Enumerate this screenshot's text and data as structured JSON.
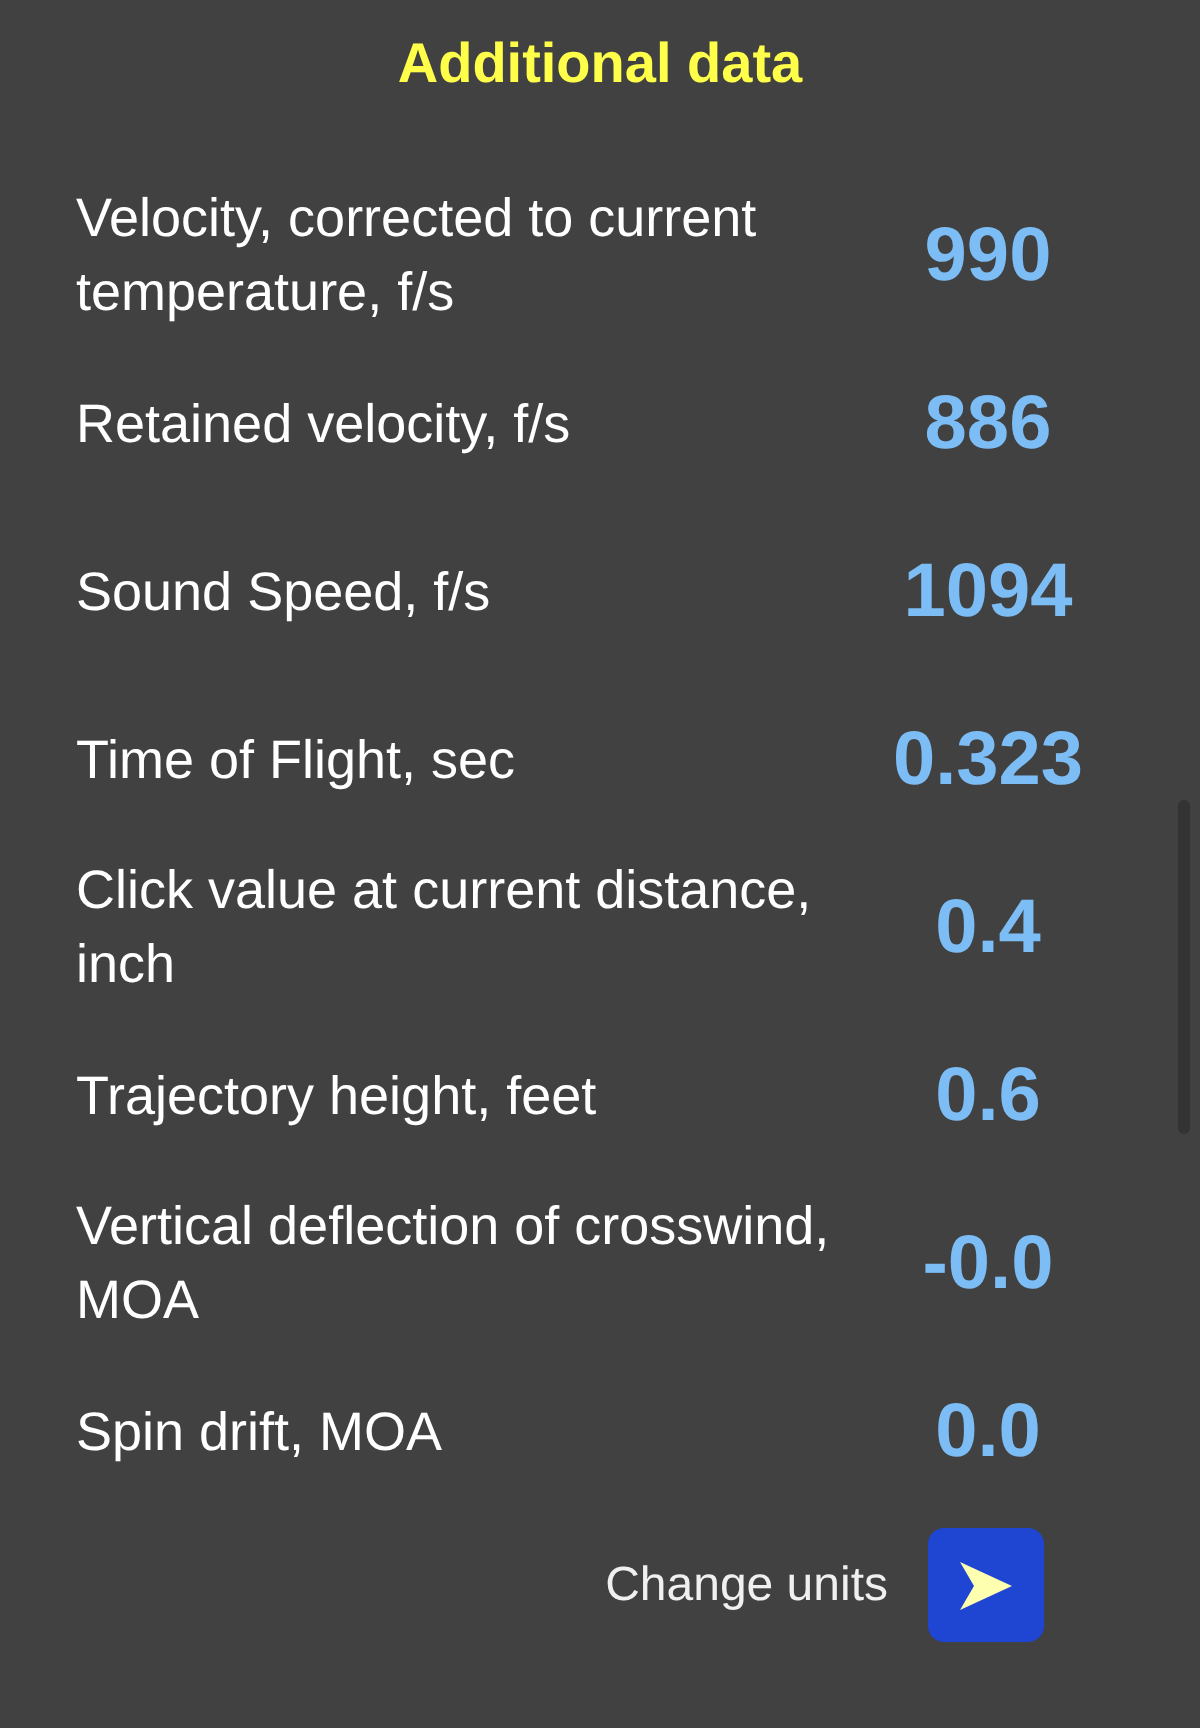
{
  "title": "Additional data",
  "rows": [
    {
      "label": "Velocity, corrected to current temperature, f/s",
      "value": "990"
    },
    {
      "label": "Retained velocity, f/s",
      "value": "886"
    },
    {
      "label": "Sound Speed, f/s",
      "value": "1094"
    },
    {
      "label": "Time of Flight, sec",
      "value": "0.323"
    },
    {
      "label": "Click value at current distance, inch",
      "value": "0.4"
    },
    {
      "label": "Trajectory height, feet",
      "value": "0.6"
    },
    {
      "label": "Vertical deflection of crosswind, MOA",
      "value": "-0.0"
    },
    {
      "label": "Spin drift, MOA",
      "value": "0.0"
    }
  ],
  "footer": {
    "label": "Change units"
  }
}
